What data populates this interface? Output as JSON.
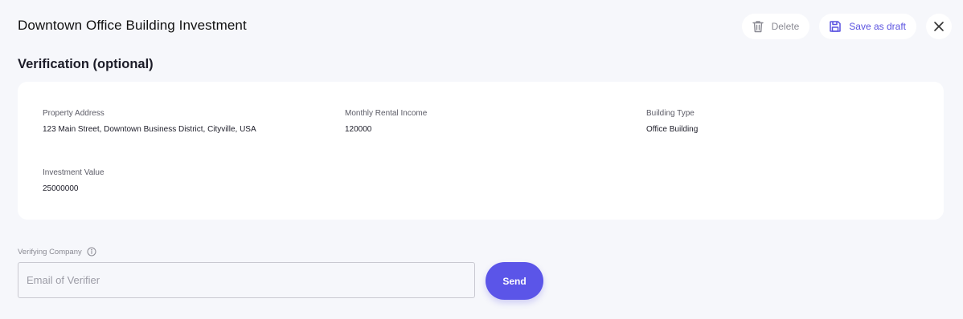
{
  "header": {
    "title": "Downtown Office Building Investment",
    "delete_label": "Delete",
    "draft_label": "Save as draft"
  },
  "section": {
    "heading": "Verification (optional)"
  },
  "details": {
    "property_address": {
      "label": "Property Address",
      "value": "123 Main Street, Downtown Business District, Cityville, USA"
    },
    "monthly_rental_income": {
      "label": "Monthly Rental Income",
      "value": "120000"
    },
    "building_type": {
      "label": "Building Type",
      "value": "Office Building"
    },
    "investment_value": {
      "label": "Investment Value",
      "value": "25000000"
    }
  },
  "verifier": {
    "label": "Verifying Company",
    "email_placeholder": "Email of Verifier",
    "email_value": "",
    "send_label": "Send"
  },
  "icons": {
    "delete": "trash-icon",
    "draft": "floppy-disk-icon",
    "close": "close-icon",
    "info": "info-icon"
  },
  "colors": {
    "accent": "#5b55e8",
    "background": "#f6f7fb",
    "card": "#ffffff",
    "muted_text": "#8a8a93"
  }
}
